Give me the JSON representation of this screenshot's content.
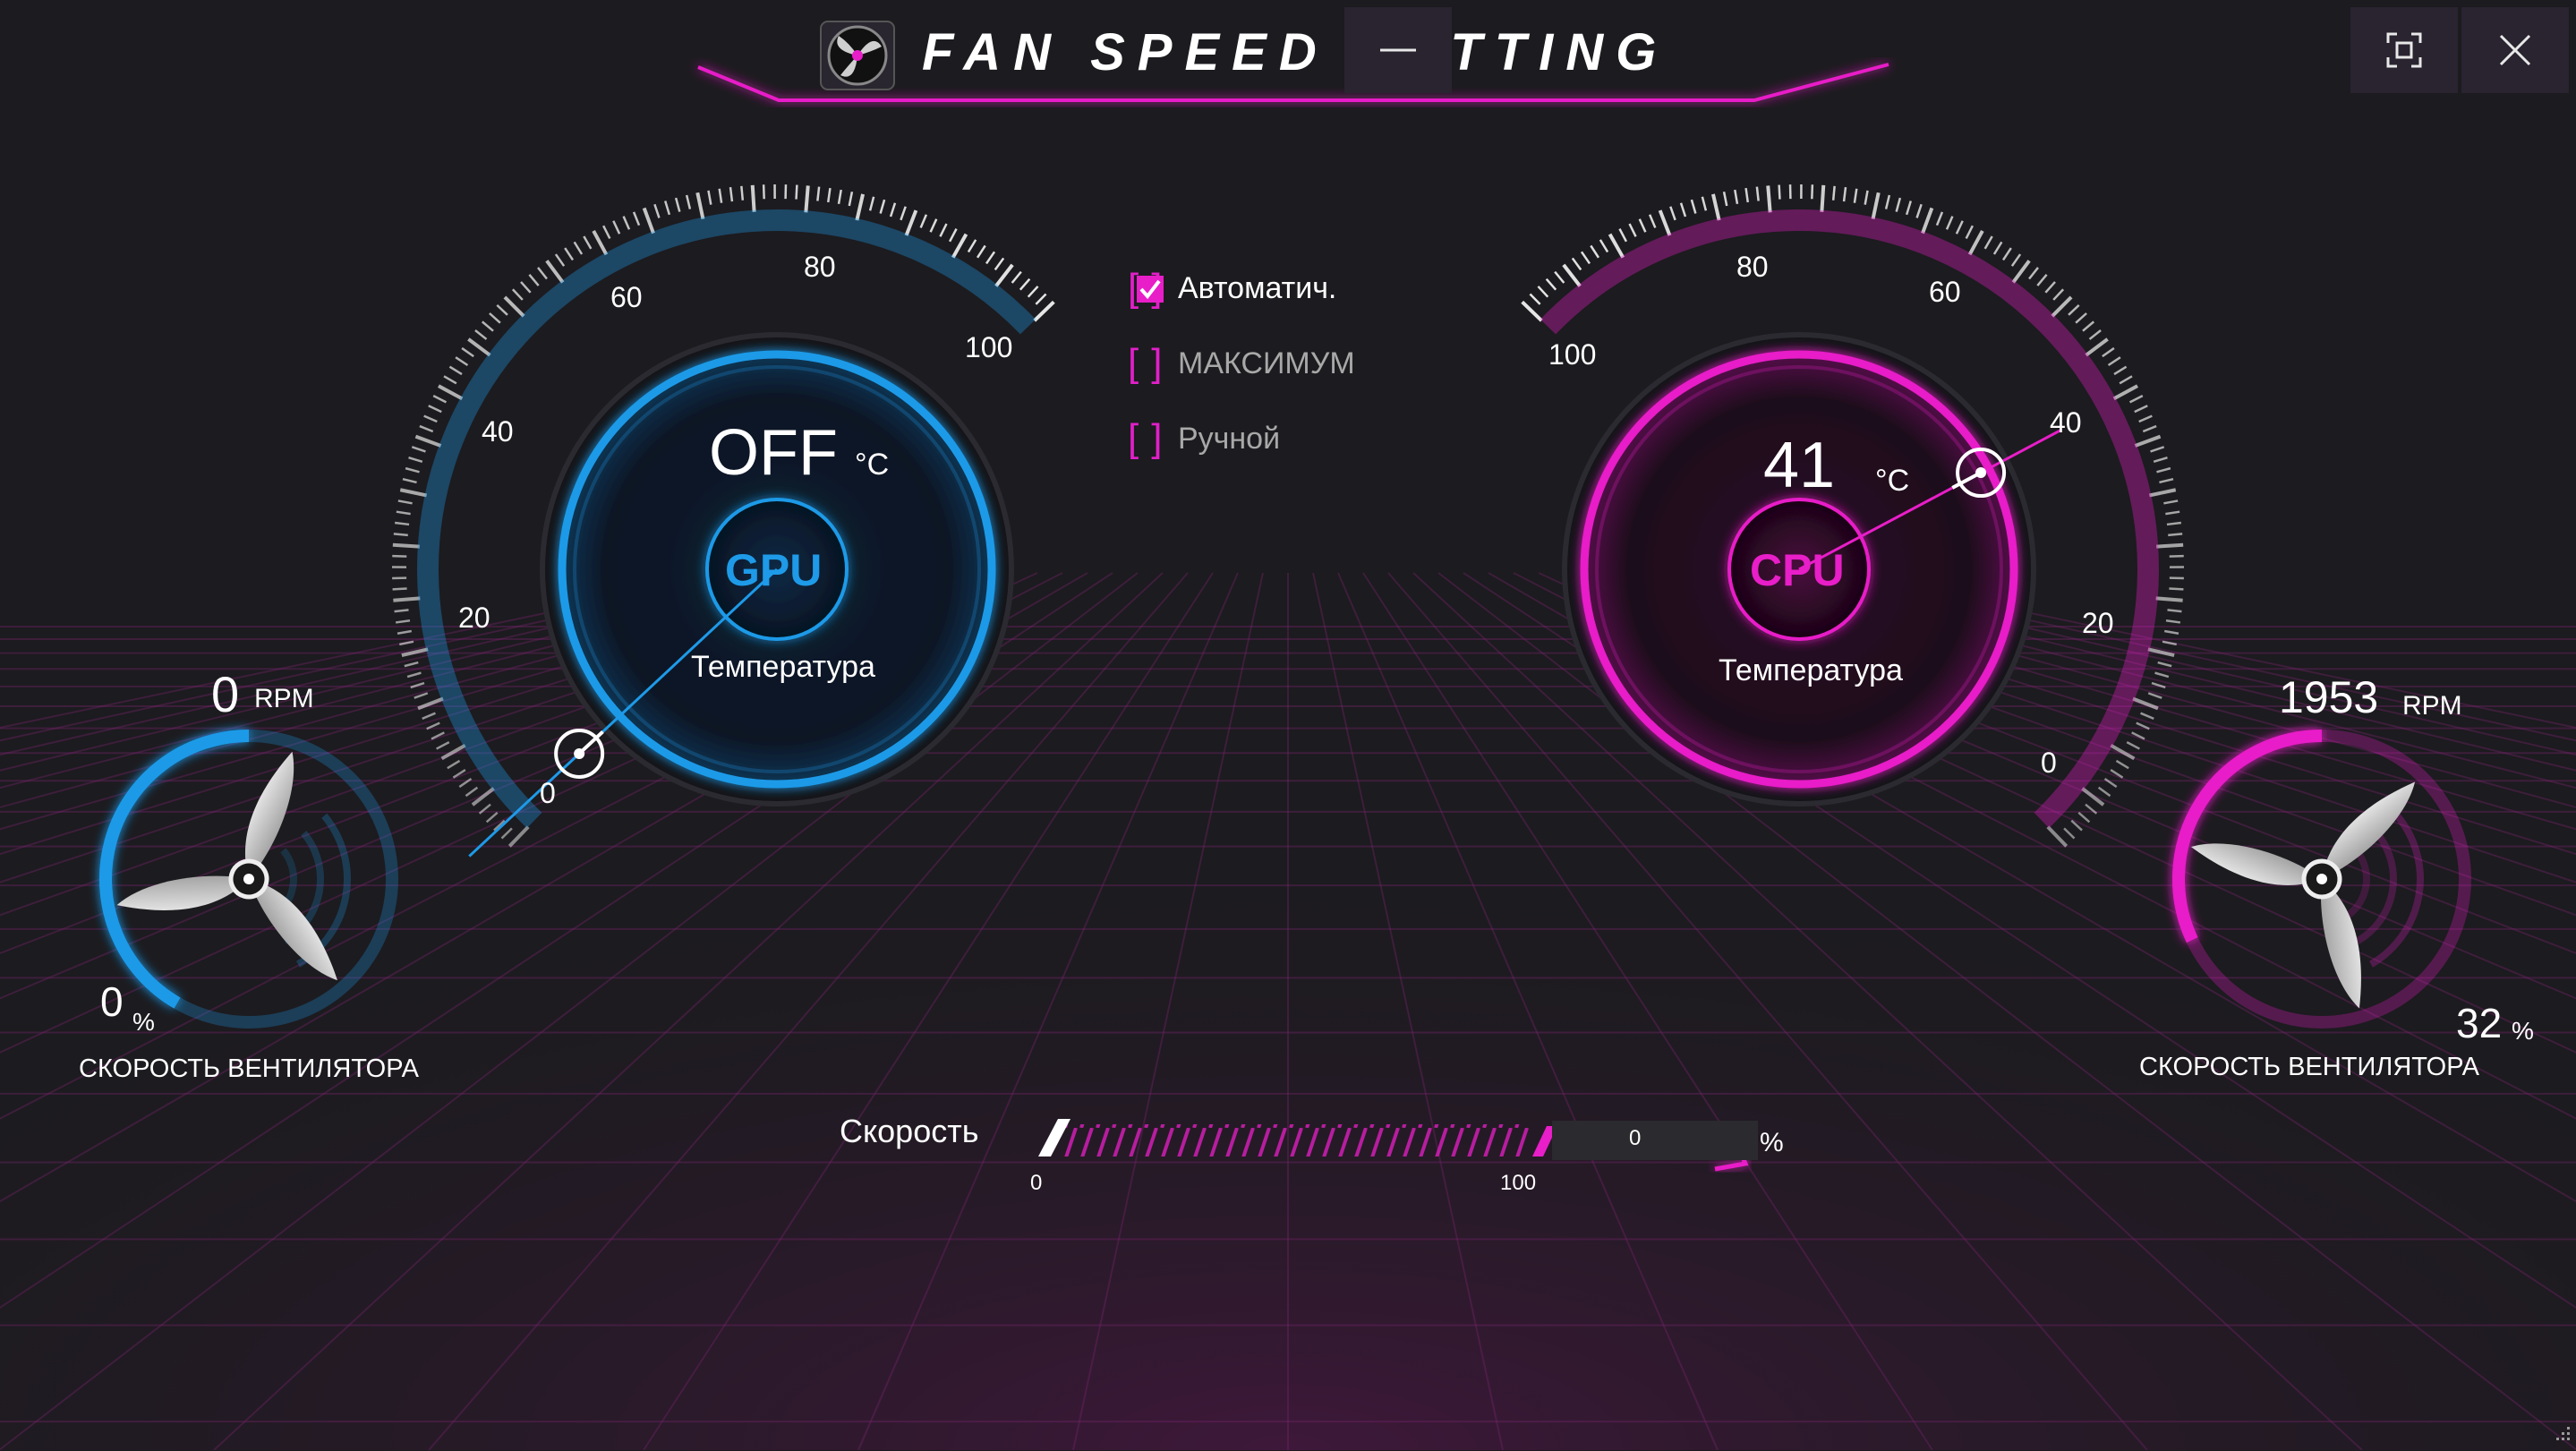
{
  "window": {
    "title": "FAN SPEED SETTING",
    "controls": {
      "minimize": "minimize-icon",
      "maximize": "maximize-icon",
      "close": "close-icon"
    }
  },
  "gpu": {
    "temperature": "OFF",
    "unit": "°C",
    "chip": "GPU",
    "caption": "Температура",
    "scale": [
      "0",
      "20",
      "40",
      "60",
      "80",
      "100"
    ],
    "fan_rpm": "0",
    "rpm_unit": "RPM",
    "fan_percent": "0",
    "percent_unit": "%",
    "fan_label": "СКОРОСТЬ ВЕНТИЛЯТОРА",
    "accent": "#1e9ae8"
  },
  "cpu": {
    "temperature": "41",
    "unit": "°C",
    "chip": "CPU",
    "caption": "Температура",
    "scale": [
      "0",
      "20",
      "40",
      "60",
      "80",
      "100"
    ],
    "fan_rpm": "1953",
    "rpm_unit": "RPM",
    "fan_percent": "32",
    "percent_unit": "%",
    "fan_label": "СКОРОСТЬ ВЕНТИЛЯТОРА",
    "accent": "#e81ec8"
  },
  "modes": [
    {
      "label": "Автоматич.",
      "checked": true
    },
    {
      "label": "МАКСИМУМ",
      "checked": false
    },
    {
      "label": "Ручной",
      "checked": false
    }
  ],
  "speed": {
    "label": "Скорость",
    "min": "0",
    "max": "100",
    "value": "0",
    "unit": "%"
  }
}
